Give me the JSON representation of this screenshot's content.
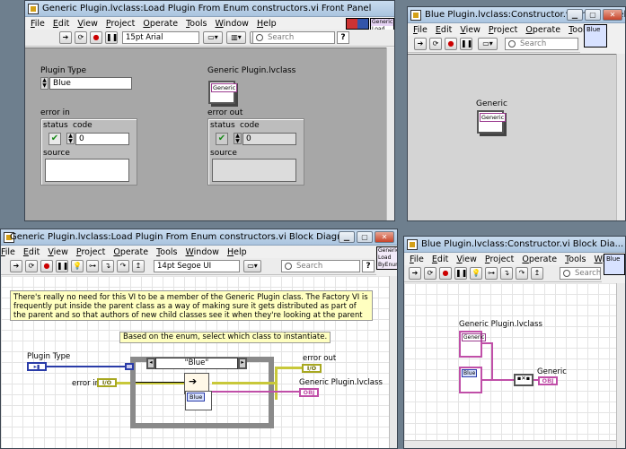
{
  "windows": {
    "front_panel": {
      "title": "Generic Plugin.lvclass:Load Plugin From Enum constructors.vi Front Panel",
      "menu": [
        "File",
        "Edit",
        "View",
        "Project",
        "Operate",
        "Tools",
        "Window",
        "Help"
      ],
      "font": "15pt Arial",
      "search_placeholder": "Search",
      "icon_lines": [
        "Generic",
        "Load",
        "ByEnum"
      ],
      "plugin_type_label": "Plugin Type",
      "plugin_type_value": "Blue",
      "generic_class_label": "Generic Plugin.lvclass",
      "generic_obj_text": "Generic",
      "error_in_label": "error in",
      "error_out_label": "error out",
      "status_label": "status",
      "code_label": "code",
      "source_label": "source",
      "code_value": "0",
      "code_out_value": "0"
    },
    "constructor_panel": {
      "title": "Blue Plugin.lvclass:Constructor.vi Front Panel",
      "menu": [
        "File",
        "Edit",
        "View",
        "Project",
        "Operate",
        "Tools"
      ],
      "search_placeholder": "Search",
      "icon_text": "Blue",
      "generic_label": "Generic",
      "generic_obj_text": "Generic"
    },
    "block_diagram": {
      "title": "Generic Plugin.lvclass:Load Plugin From Enum constructors.vi Block Diagram",
      "menu": [
        "File",
        "Edit",
        "View",
        "Project",
        "Operate",
        "Tools",
        "Window",
        "Help"
      ],
      "font": "14pt Segoe UI",
      "search_placeholder": "Search",
      "comment": "There's really no need for this VI to be a member of the Generic Plugin class. The Factory VI is frequently put inside the parent class as a way of making sure it gets distributed as part of the parent and so that authors of new child classes see it when they're looking at the parent class and so they don't forget to update the factory VI.",
      "note": "Based on the enum, select which class to instantiate.",
      "plugin_type_label": "Plugin Type",
      "error_in_label": "error in",
      "error_out_label": "error out",
      "generic_class_label": "Generic Plugin.lvclass",
      "case_selector": "\"Blue\"",
      "blue_const_text": "Blue",
      "obj_tag": "OBJ",
      "err_tag": "I/O"
    },
    "constructor_diagram": {
      "title": "Blue Plugin.lvclass:Constructor.vi Block Dia...",
      "menu": [
        "File",
        "Edit",
        "View",
        "Project",
        "Operate",
        "Tools",
        "Window"
      ],
      "search_placeholder": "Search",
      "icon_text": "Blue",
      "generic_class_label": "Generic Plugin.lvclass",
      "generic_const_text": "Generic",
      "blue_const_text": "Blue",
      "generic_out_label": "Generic"
    }
  },
  "colors": {
    "class_wire": "#c04fa8",
    "error_wire": "#c8c83a",
    "enum_wire": "#2a3ca8",
    "panel_bg": "#a7a7a7"
  }
}
